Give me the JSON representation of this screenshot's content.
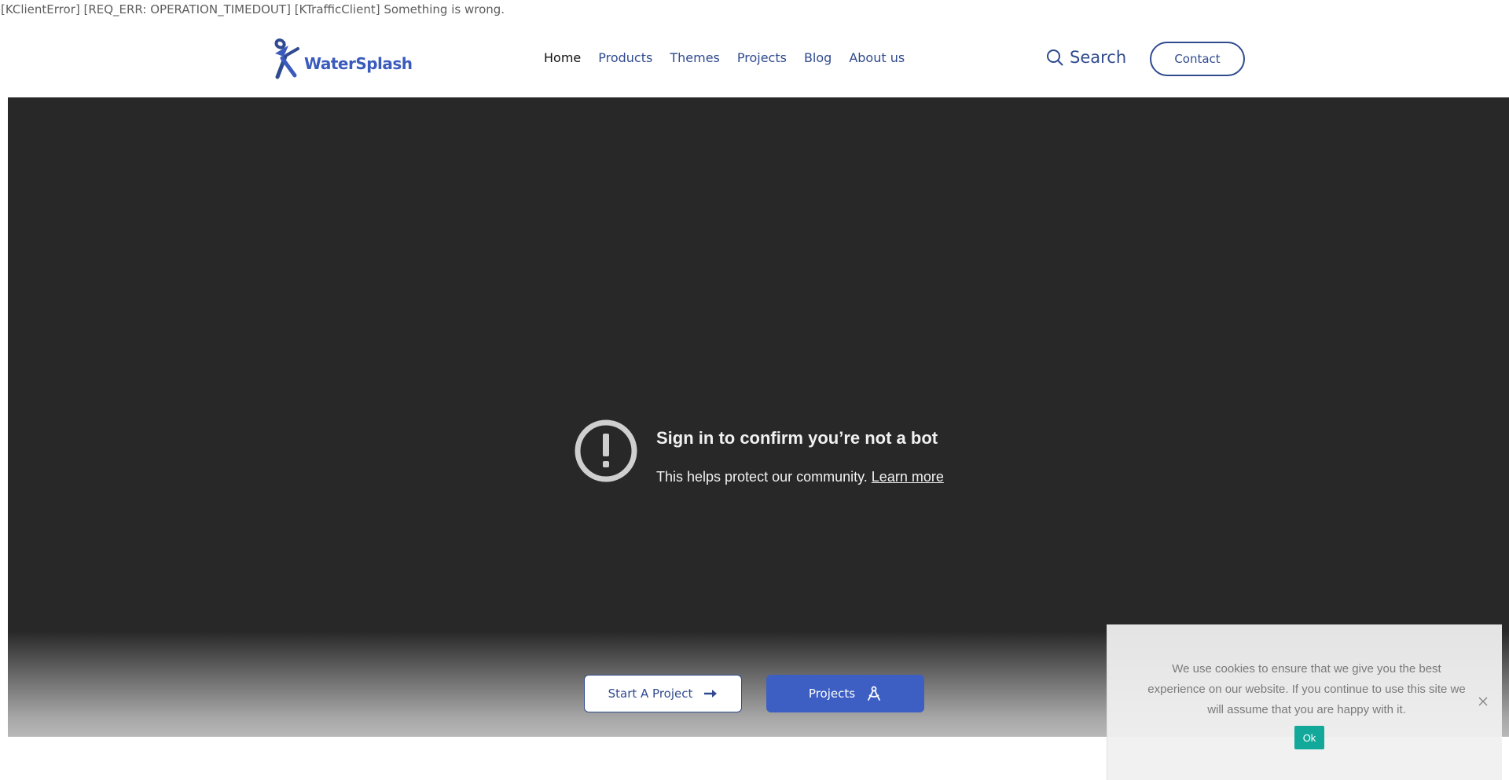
{
  "error_message": "[KClientError] [REQ_ERR: OPERATION_TIMEDOUT] [KTrafficClient] Something is wrong.",
  "header": {
    "logo_text": "WaterSplash",
    "nav": [
      {
        "label": "Home",
        "active": true
      },
      {
        "label": "Products",
        "active": false
      },
      {
        "label": "Themes",
        "active": false
      },
      {
        "label": "Projects",
        "active": false
      },
      {
        "label": "Blog",
        "active": false
      },
      {
        "label": "About us",
        "active": false
      }
    ],
    "search_label": "Search",
    "contact_label": "Contact"
  },
  "video": {
    "title": "Sign in to confirm you’re not a bot",
    "body": "This helps protect our community.",
    "learn_more": "Learn more"
  },
  "cta": {
    "start_project": "Start A Project",
    "projects": "Projects"
  },
  "cookie": {
    "text": "We use cookies to ensure that we give you the best experience on our website. If you continue to use this site we will assume that you are happy with it.",
    "ok_label": "Ok"
  },
  "colors": {
    "brand": "#3d5fc4",
    "nav_text": "#2f4a8f",
    "cookie_ok": "#12a89a",
    "video_bg": "#282828"
  },
  "icons": {
    "logo": "watersplash-figure-logo",
    "search": "magnifier-icon",
    "notice": "exclamation-circle-icon",
    "start_project": "arrow-right-icon",
    "projects": "compass-drafting-icon",
    "cookie_close": "close-icon"
  }
}
